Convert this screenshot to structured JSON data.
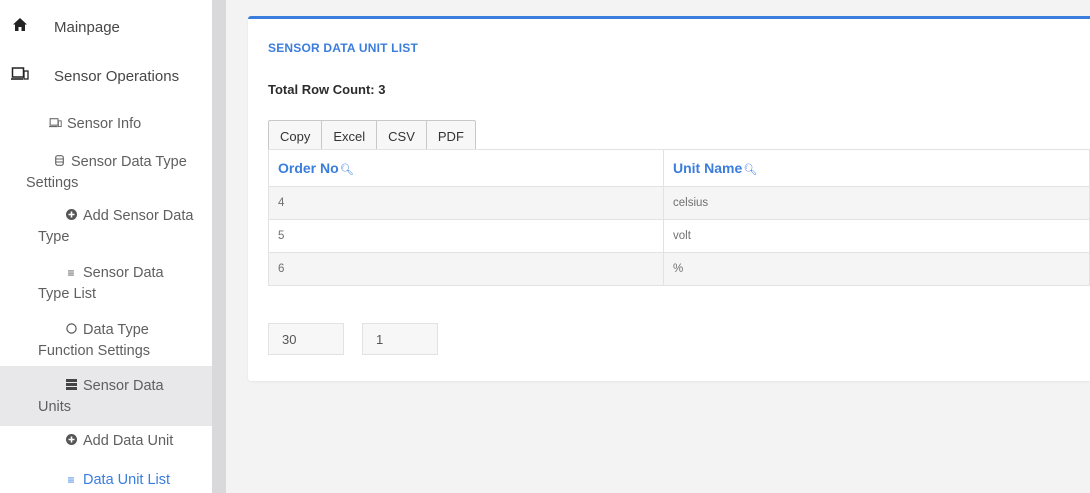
{
  "sidebar": {
    "main_items": [
      {
        "label": "Mainpage",
        "icon": "home-icon"
      },
      {
        "label": "Sensor Operations",
        "icon": "laptop-icon"
      }
    ],
    "sub_items": [
      {
        "label": "Sensor Info",
        "icon": "laptop-icon"
      },
      {
        "label": "Sensor Data Type Settings",
        "icon": "database-icon"
      },
      {
        "label": "Add Sensor Data Type",
        "icon": "plus-circle-icon"
      },
      {
        "label": "Sensor Data Type List",
        "icon": "list-icon"
      },
      {
        "label": "Data Type Function Settings",
        "icon": "circle-icon"
      },
      {
        "label": "Sensor Data Units",
        "icon": "server-icon"
      },
      {
        "label": "Add Data Unit",
        "icon": "plus-circle-icon"
      },
      {
        "label": "Data Unit List",
        "icon": "list-icon"
      }
    ],
    "accent_color": "#3b7ddd"
  },
  "panel": {
    "title": "SENSOR DATA UNIT LIST",
    "row_count": "Total Row Count: 3",
    "export_buttons": [
      "Copy",
      "Excel",
      "CSV",
      "PDF"
    ],
    "table": {
      "columns": [
        "Order No",
        "Unit Name"
      ],
      "rows": [
        [
          "4",
          "celsius"
        ],
        [
          "5",
          "volt"
        ],
        [
          "6",
          "%"
        ]
      ]
    },
    "pagination": {
      "page_size": "30",
      "page_number": "1"
    }
  }
}
